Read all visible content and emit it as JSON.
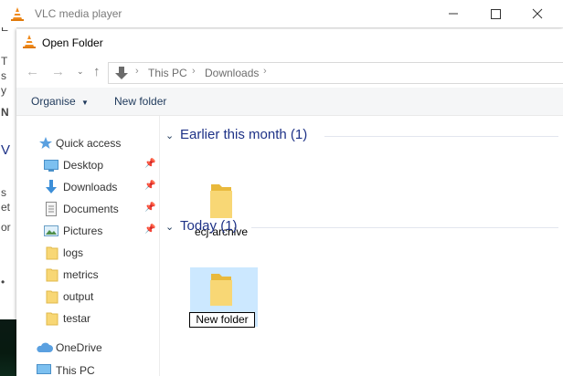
{
  "vlc": {
    "title": "VLC media player",
    "left_letters": [
      "C",
      "E",
      "T",
      "s",
      "y",
      "N",
      "V",
      "s",
      "et",
      "or",
      "•"
    ]
  },
  "dialog": {
    "title": "Open Folder",
    "address": {
      "crumbs": [
        "This PC",
        "Downloads"
      ]
    },
    "toolbar": {
      "organise": "Organise",
      "new_folder": "New folder"
    },
    "nav": {
      "quick_access": "Quick access",
      "items": [
        {
          "label": "Desktop",
          "icon": "desktop-icon",
          "pinned": true
        },
        {
          "label": "Downloads",
          "icon": "downloads-icon",
          "pinned": true
        },
        {
          "label": "Documents",
          "icon": "documents-icon",
          "pinned": true
        },
        {
          "label": "Pictures",
          "icon": "pictures-icon",
          "pinned": true
        },
        {
          "label": "logs",
          "icon": "folder-icon",
          "pinned": false
        },
        {
          "label": "metrics",
          "icon": "folder-icon",
          "pinned": false
        },
        {
          "label": "output",
          "icon": "folder-icon",
          "pinned": false
        },
        {
          "label": "testar",
          "icon": "folder-icon",
          "pinned": false
        }
      ],
      "onedrive": "OneDrive",
      "this_pc": "This PC"
    },
    "groups": [
      {
        "title": "Earlier this month (1)",
        "items": [
          {
            "name": "ecj-archive"
          }
        ]
      },
      {
        "title": "Today (1)",
        "items": [
          {
            "name": "New folder",
            "selected": true,
            "renaming": true
          }
        ]
      }
    ]
  },
  "colors": {
    "accent": "#1e3287",
    "selection": "#cce8ff",
    "folder": "#f8d775"
  }
}
